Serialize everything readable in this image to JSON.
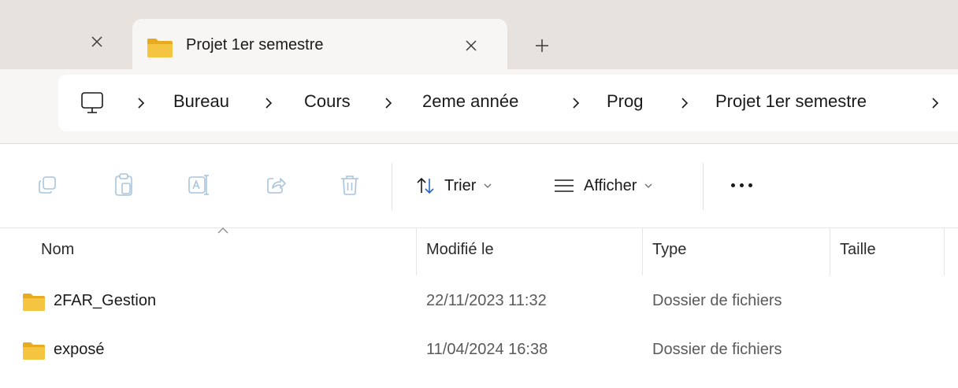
{
  "tabs": {
    "active_title": "Projet 1er semestre",
    "close_glyph": "×",
    "new_tab_glyph": "+"
  },
  "address": {
    "root_icon": "this-pc-icon",
    "crumbs": [
      "Bureau",
      "Cours",
      "2eme année",
      "Prog",
      "Projet 1er semestre"
    ]
  },
  "toolbar": {
    "sort_label": "Trier",
    "view_label": "Afficher",
    "icons": [
      "copy-icon",
      "paste-icon",
      "rename-icon",
      "share-icon",
      "delete-icon",
      "sort-icon",
      "view-icon",
      "more-icon"
    ]
  },
  "columns": {
    "name": "Nom",
    "modified": "Modifié le",
    "type": "Type",
    "size": "Taille"
  },
  "files": [
    {
      "name": "2FAR_Gestion",
      "modified": "22/11/2023 11:32",
      "type": "Dossier de fichiers",
      "size": ""
    },
    {
      "name": "exposé",
      "modified": "11/04/2024 16:38",
      "type": "Dossier de fichiers",
      "size": ""
    }
  ],
  "colors": {
    "tab_strip": "#e7e2de",
    "active_tab": "#f8f6f4",
    "folder_yellow": "#f5c542",
    "folder_yellow_dark": "#e8aa1f",
    "disabled_icon": "#a9c4dd"
  }
}
